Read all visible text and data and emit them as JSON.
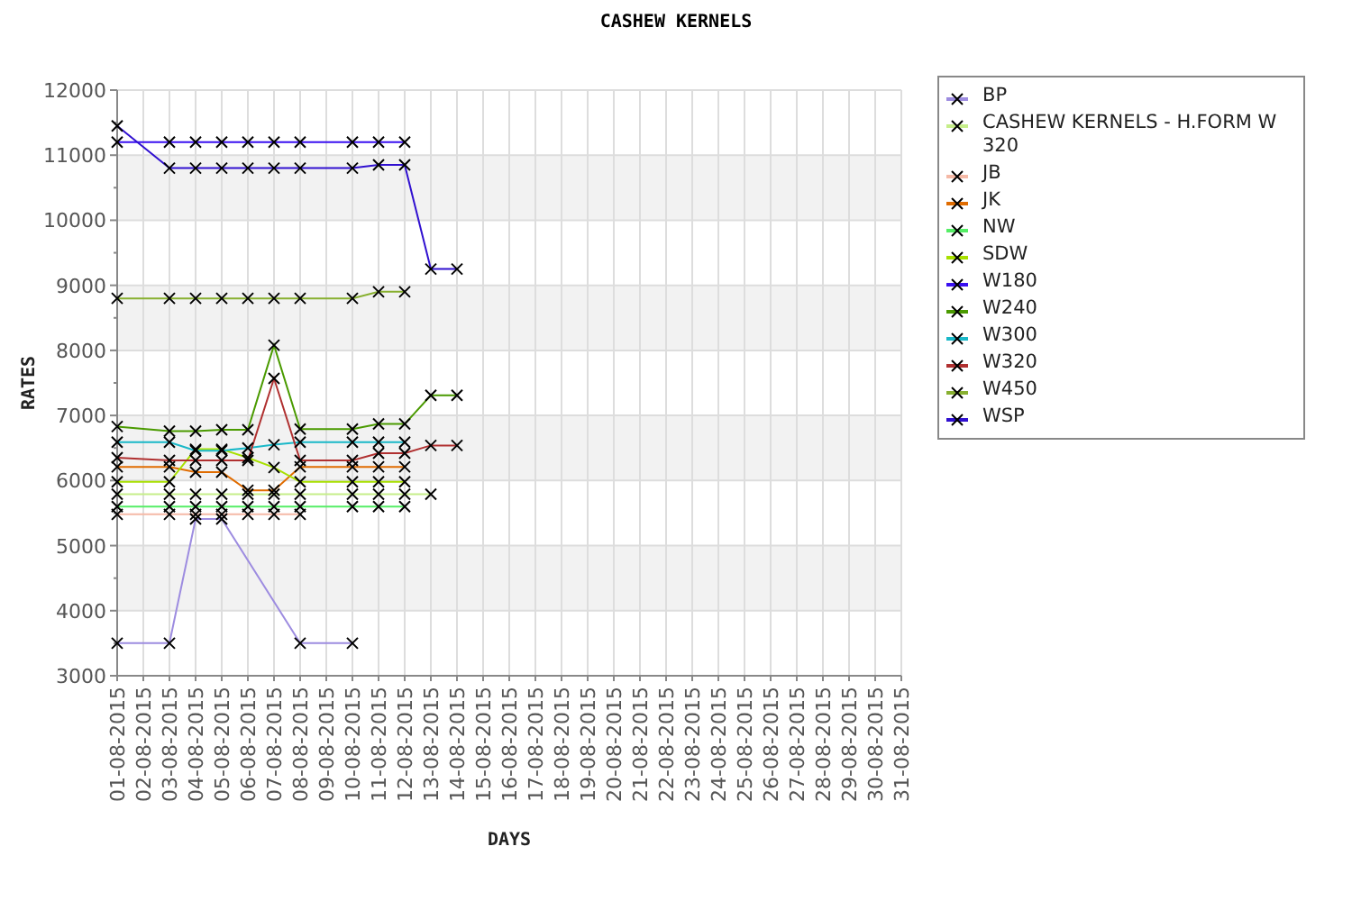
{
  "chart": {
    "chart_data": {
      "type": "line",
      "title": "CASHEW KERNELS",
      "xlabel": "DAYS",
      "ylabel": "RATES",
      "categories": [
        "01-08-2015",
        "02-08-2015",
        "03-08-2015",
        "04-08-2015",
        "05-08-2015",
        "06-08-2015",
        "07-08-2015",
        "08-08-2015",
        "09-08-2015",
        "10-08-2015",
        "11-08-2015",
        "12-08-2015",
        "13-08-2015",
        "14-08-2015",
        "15-08-2015",
        "16-08-2015",
        "17-08-2015",
        "18-08-2015",
        "19-08-2015",
        "20-08-2015",
        "21-08-2015",
        "22-08-2015",
        "23-08-2015",
        "24-08-2015",
        "25-08-2015",
        "26-08-2015",
        "27-08-2015",
        "28-08-2015",
        "29-08-2015",
        "30-08-2015",
        "31-08-2015"
      ],
      "ylim": [
        3000,
        12000
      ],
      "grid": true,
      "yticks": [
        3000,
        4000,
        5000,
        6000,
        7000,
        8000,
        9000,
        10000,
        11000,
        12000
      ],
      "series": [
        {
          "name": "BP",
          "color": "#9d8ce0",
          "marker": "x",
          "values": [
            3500,
            null,
            3500,
            5410,
            5410,
            null,
            null,
            3500,
            null,
            3500,
            null,
            null,
            null,
            null,
            null,
            null,
            null,
            null,
            null,
            null,
            null,
            null,
            null,
            null,
            null,
            null,
            null,
            null,
            null,
            null,
            null
          ]
        },
        {
          "name": "CASHEW KERNELS - H.FORM W 320",
          "color": "#c6ee8a",
          "marker": "x",
          "values": [
            5790,
            null,
            5790,
            5790,
            5790,
            5790,
            5790,
            5790,
            null,
            5790,
            5790,
            5790,
            5790,
            null,
            null,
            null,
            null,
            null,
            null,
            null,
            null,
            null,
            null,
            null,
            null,
            null,
            null,
            null,
            null,
            null,
            null
          ]
        },
        {
          "name": "JB",
          "color": "#f5b9a6",
          "marker": "x",
          "values": [
            5480,
            null,
            5480,
            5480,
            5480,
            5480,
            5480,
            5480,
            null,
            null,
            null,
            null,
            null,
            null,
            null,
            null,
            null,
            null,
            null,
            null,
            null,
            null,
            null,
            null,
            null,
            null,
            null,
            null,
            null,
            null,
            null
          ]
        },
        {
          "name": "JK",
          "color": "#e06c00",
          "marker": "x",
          "values": [
            6210,
            null,
            6210,
            6130,
            6130,
            5850,
            5850,
            6210,
            null,
            6210,
            6210,
            6210,
            null,
            null,
            null,
            null,
            null,
            null,
            null,
            null,
            null,
            null,
            null,
            null,
            null,
            null,
            null,
            null,
            null,
            null,
            null
          ]
        },
        {
          "name": "NW",
          "color": "#55ee66",
          "marker": "x",
          "values": [
            5600,
            null,
            5600,
            5600,
            5600,
            5600,
            5600,
            5600,
            null,
            5600,
            5600,
            5600,
            null,
            null,
            null,
            null,
            null,
            null,
            null,
            null,
            null,
            null,
            null,
            null,
            null,
            null,
            null,
            null,
            null,
            null,
            null
          ]
        },
        {
          "name": "SDW",
          "color": "#a8e000",
          "marker": "x",
          "values": [
            5980,
            null,
            5980,
            6480,
            6480,
            6350,
            6200,
            5980,
            null,
            5980,
            5980,
            5980,
            null,
            null,
            null,
            null,
            null,
            null,
            null,
            null,
            null,
            null,
            null,
            null,
            null,
            null,
            null,
            null,
            null,
            null,
            null
          ]
        },
        {
          "name": "W180",
          "color": "#3a10f0",
          "marker": "x",
          "values": [
            11200,
            null,
            11200,
            11200,
            11200,
            11200,
            11200,
            11200,
            null,
            11200,
            11200,
            11200,
            null,
            null,
            null,
            null,
            null,
            null,
            null,
            null,
            null,
            null,
            null,
            null,
            null,
            null,
            null,
            null,
            null,
            null,
            null
          ]
        },
        {
          "name": "W240",
          "color": "#4a9a00",
          "marker": "x",
          "values": [
            6830,
            null,
            6760,
            6760,
            6780,
            6780,
            8080,
            6790,
            null,
            6790,
            6870,
            6870,
            7310,
            7310,
            null,
            null,
            null,
            null,
            null,
            null,
            null,
            null,
            null,
            null,
            null,
            null,
            null,
            null,
            null,
            null,
            null
          ]
        },
        {
          "name": "W300",
          "color": "#1ab8c8",
          "marker": "x",
          "values": [
            6590,
            null,
            6590,
            6460,
            6460,
            6500,
            6550,
            6590,
            null,
            6590,
            6590,
            6590,
            null,
            null,
            null,
            null,
            null,
            null,
            null,
            null,
            null,
            null,
            null,
            null,
            null,
            null,
            null,
            null,
            null,
            null,
            null
          ]
        },
        {
          "name": "W320",
          "color": "#b03030",
          "marker": "x",
          "values": [
            6350,
            null,
            6310,
            6310,
            6310,
            6310,
            7570,
            6310,
            null,
            6310,
            6420,
            6420,
            6540,
            6540,
            null,
            null,
            null,
            null,
            null,
            null,
            null,
            null,
            null,
            null,
            null,
            null,
            null,
            null,
            null,
            null,
            null
          ]
        },
        {
          "name": "W450",
          "color": "#88b030",
          "marker": "x",
          "values": [
            8800,
            null,
            8800,
            8800,
            8800,
            8800,
            8800,
            8800,
            null,
            8800,
            8900,
            8900,
            null,
            null,
            null,
            null,
            null,
            null,
            null,
            null,
            null,
            null,
            null,
            null,
            null,
            null,
            null,
            null,
            null,
            null,
            null
          ]
        },
        {
          "name": "WSP",
          "color": "#3010d0",
          "marker": "x",
          "values": [
            11450,
            null,
            10800,
            10800,
            10800,
            10800,
            10800,
            10800,
            null,
            10800,
            10850,
            10850,
            9250,
            9250,
            null,
            null,
            null,
            null,
            null,
            null,
            null,
            null,
            null,
            null,
            null,
            null,
            null,
            null,
            null,
            null,
            null
          ]
        }
      ]
    }
  }
}
